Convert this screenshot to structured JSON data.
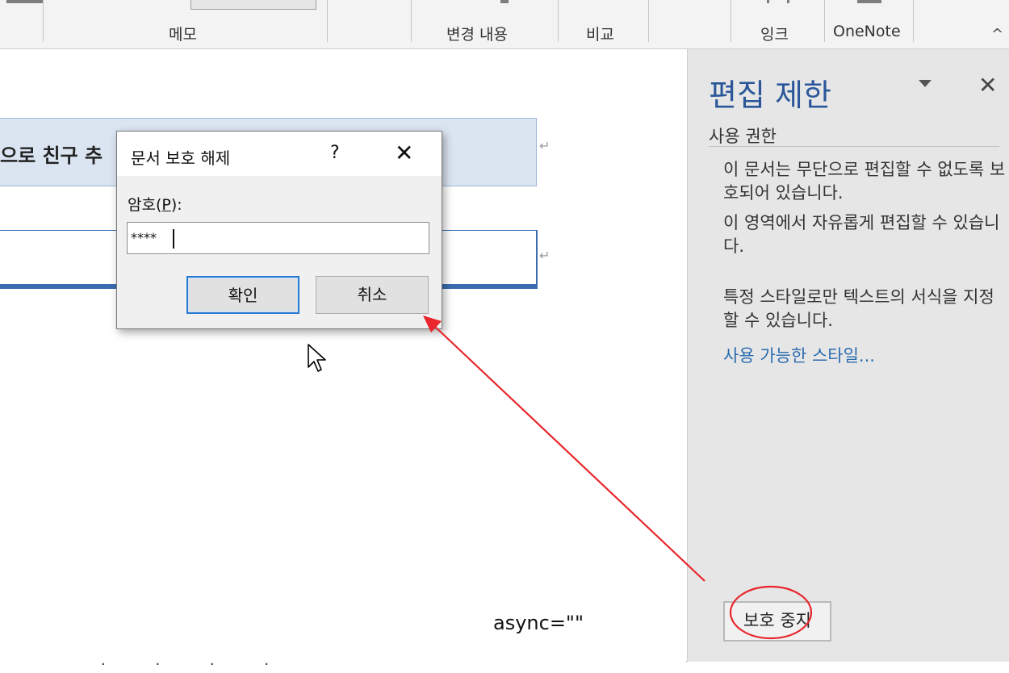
{
  "ribbon": {
    "groups": {
      "memo": "메모",
      "changes": "변경 내용",
      "compare": "비교",
      "ink": "잉크",
      "onenote": "OneNote"
    },
    "collapse_icon": "chevron-up-icon"
  },
  "document": {
    "cell1_text": "으로 친구 추",
    "para_mark": "↵",
    "async_text": "async=\"\"",
    "frag_text": "· · · ·"
  },
  "pane": {
    "title": "편집 제한",
    "close_glyph": "✕",
    "section": "사용 권한",
    "para1": "이 문서는 무단으로 편집할 수 없도록 보호되어 있습니다.",
    "para2": "이 영역에서 자유롭게 편집할 수 있습니다.",
    "para3": "특정 스타일로만 텍스트의 서식을 지정할 수 있습니다.",
    "styles_link": "사용 가능한 스타일...",
    "stop_button": "보호 중지"
  },
  "dialog": {
    "title": "문서 보호 해제",
    "help": "?",
    "close": "✕",
    "password_label_prefix": "암호(",
    "password_label_key": "P",
    "password_label_suffix": "):",
    "password_value": "****",
    "ok_button": "확인",
    "cancel_button": "취소"
  },
  "annotation": {
    "color": "#e8262b"
  }
}
